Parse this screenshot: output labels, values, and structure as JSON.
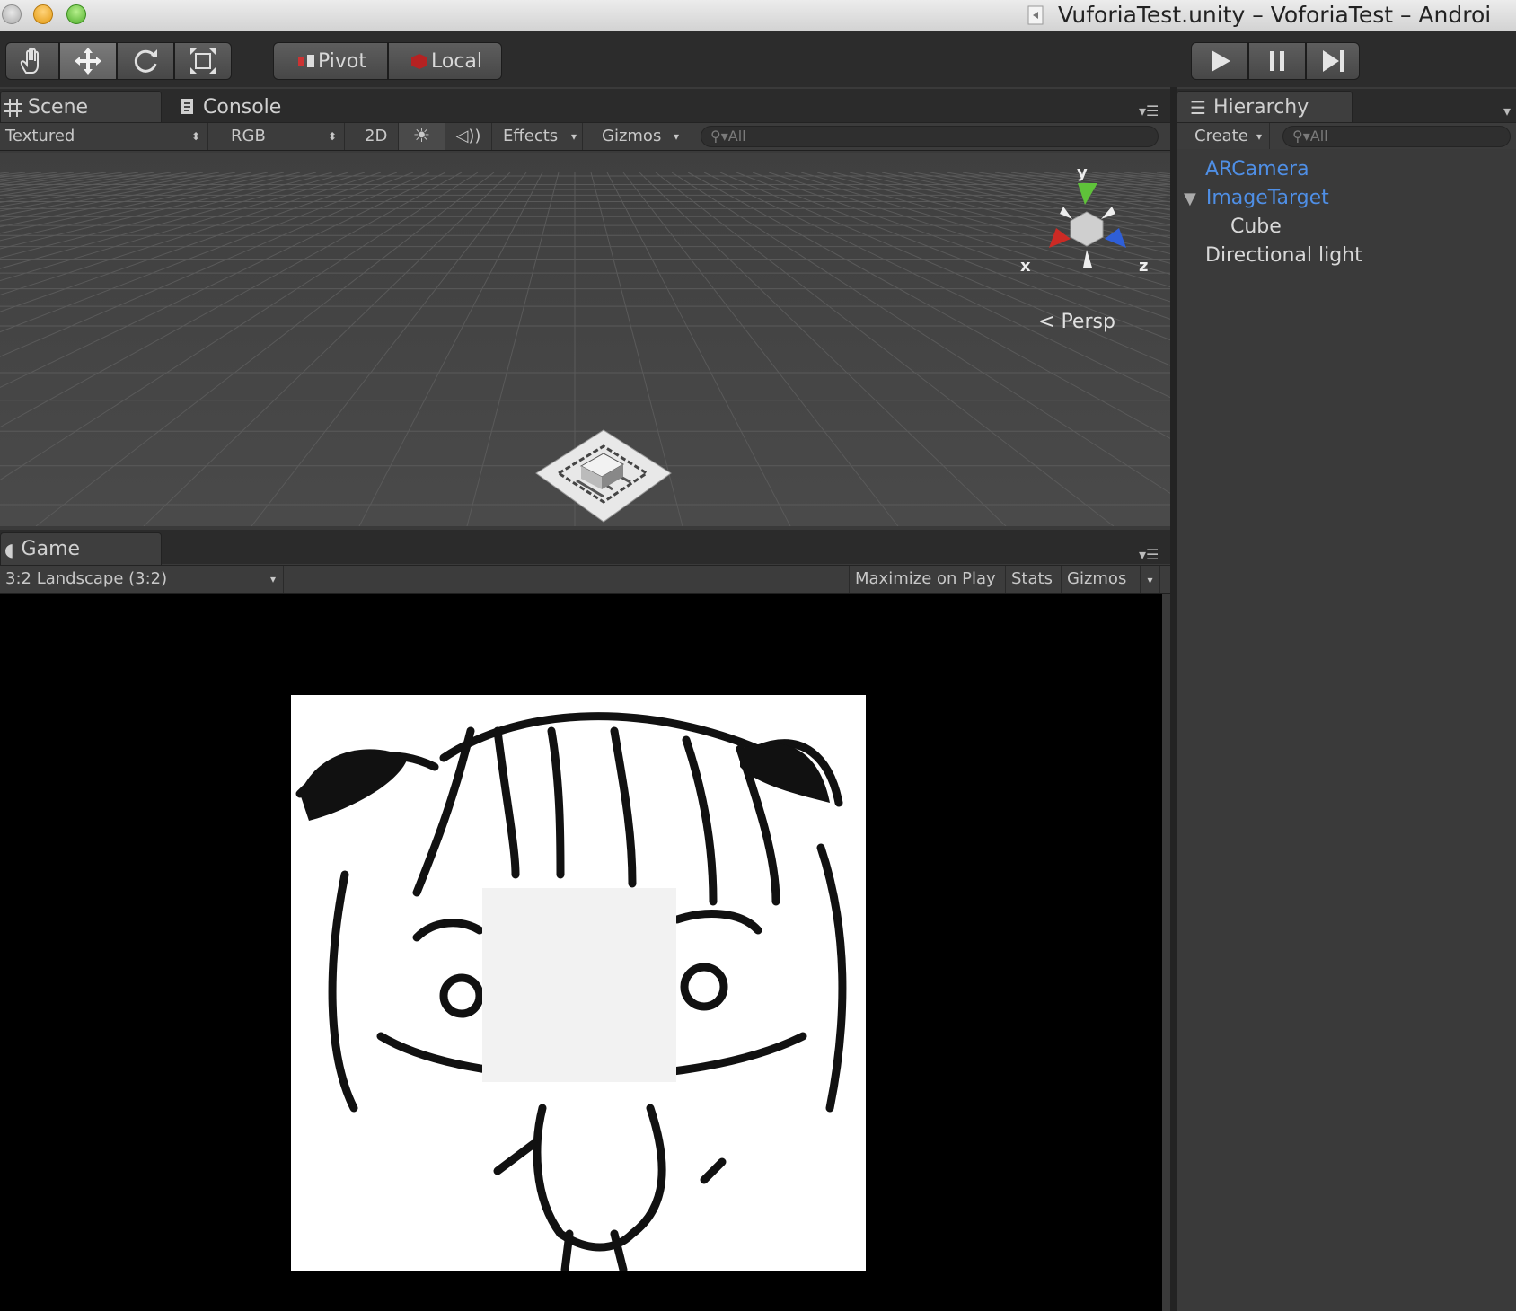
{
  "window": {
    "title": "VuforiaTest.unity – VoforiaTest – Androi",
    "traffic_lights": [
      "close",
      "minimize",
      "zoom"
    ]
  },
  "toolbar": {
    "tools": [
      {
        "name": "hand-tool",
        "icon": "hand-icon"
      },
      {
        "name": "move-tool",
        "icon": "move-arrows-icon",
        "active": true
      },
      {
        "name": "rotate-tool",
        "icon": "rotate-icon"
      },
      {
        "name": "scale-tool",
        "icon": "scale-icon"
      }
    ],
    "pivot_label": "Pivot",
    "local_label": "Local",
    "playback": [
      "play-icon",
      "pause-icon",
      "step-icon"
    ]
  },
  "scene_panel": {
    "tabs": [
      {
        "label": "Scene",
        "icon": "grid-icon",
        "active": true
      },
      {
        "label": "Console",
        "icon": "console-icon",
        "active": false
      }
    ],
    "shading_mode": "Textured",
    "render_mode": "RGB",
    "mode_2d": "2D",
    "effects_label": "Effects",
    "gizmos_label": "Gizmos",
    "search_placeholder": "All",
    "gizmo": {
      "y_label": "y",
      "x_label": "x",
      "z_label": "z",
      "projection_label": "Persp"
    }
  },
  "game_panel": {
    "tab_label": "Game",
    "aspect": "3:2 Landscape (3:2)",
    "maximize_on_play": "Maximize on Play",
    "stats": "Stats",
    "gizmos": "Gizmos"
  },
  "hierarchy_panel": {
    "tab_label": "Hierarchy",
    "create_label": "Create",
    "search_placeholder": "All",
    "items": [
      {
        "label": "ARCamera",
        "color": "#4f8fe6",
        "selected_style": true
      },
      {
        "label": "ImageTarget",
        "color": "#4f8fe6",
        "expanded": true
      },
      {
        "label": "Cube",
        "color": "#d8d8d8"
      },
      {
        "label": "Directional light",
        "color": "#d8d8d8"
      }
    ]
  },
  "colors": {
    "axis_y": "#5fc23a",
    "axis_x": "#cc2a24",
    "axis_z": "#2f5fd8",
    "prefab_blue": "#4f8fe6"
  }
}
